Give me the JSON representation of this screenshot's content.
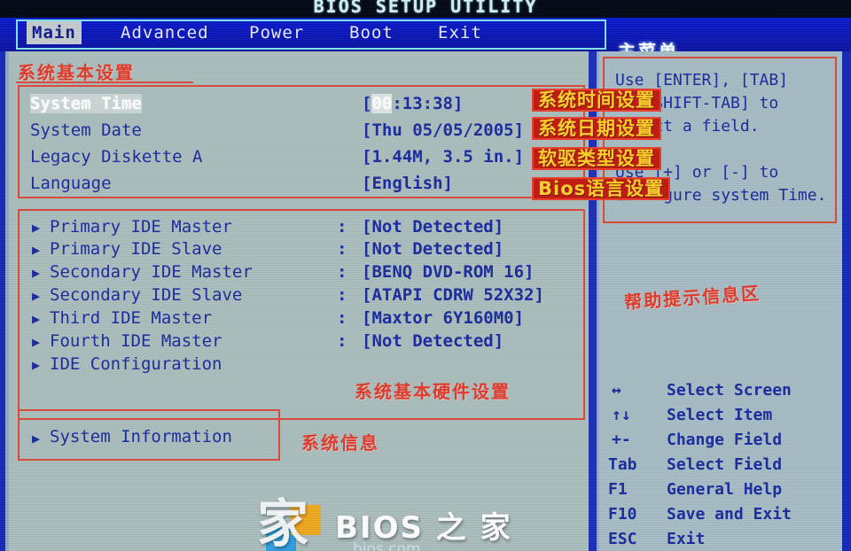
{
  "window": {
    "title": "BIOS SETUP UTILITY",
    "main_menu_label_cn": "主菜单"
  },
  "menu": {
    "items": [
      {
        "label": "Main",
        "active": true
      },
      {
        "label": "Advanced",
        "active": false
      },
      {
        "label": "Power",
        "active": false
      },
      {
        "label": "Boot",
        "active": false
      },
      {
        "label": "Exit",
        "active": false
      }
    ]
  },
  "main": {
    "section_basic_cn": "系统基本设置",
    "section_hardware_cn": "系统基本硬件设置",
    "section_sysinfo_cn": "系统信息",
    "basic_settings": [
      {
        "label": "System Time",
        "value": "[00:13:38]",
        "selected": true,
        "value_highlight": "00"
      },
      {
        "label": "System Date",
        "value": "[Thu 05/05/2005]",
        "selected": false
      },
      {
        "label": "Legacy Diskette A",
        "value": "[1.44M, 3.5 in.]",
        "selected": false
      },
      {
        "label": "Language",
        "value": "[English]",
        "selected": false
      }
    ],
    "ide_devices": [
      {
        "label": "Primary IDE Master",
        "value": "[Not Detected]"
      },
      {
        "label": "Primary IDE Slave",
        "value": "[Not Detected]"
      },
      {
        "label": "Secondary IDE Master",
        "value": "[BENQ    DVD-ROM 16]"
      },
      {
        "label": "Secondary IDE Slave",
        "value": "[ATAPI   CDRW 52X32]"
      },
      {
        "label": "Third IDE Master",
        "value": "[Maxtor 6Y160M0]"
      },
      {
        "label": "Fourth IDE Master",
        "value": "[Not Detected]"
      },
      {
        "label": "IDE Configuration",
        "value": ""
      }
    ],
    "system_information": {
      "label": "System Information"
    }
  },
  "annotations": {
    "yellow": [
      "系统时间设置",
      "系统日期设置",
      "软驱类型设置",
      "Bios语言设置"
    ],
    "help_area_cn": "帮助提示信息区"
  },
  "help": {
    "lines": [
      "Use [ENTER], [TAB]",
      "or [SHIFT-TAB] to",
      "select a field.",
      "",
      "Use [+] or [-] to",
      "configure system Time."
    ]
  },
  "keys": [
    {
      "key": "↔",
      "desc": "Select Screen"
    },
    {
      "key": "↑↓",
      "desc": "Select Item"
    },
    {
      "key": "+-",
      "desc": "Change Field"
    },
    {
      "key": "Tab",
      "desc": "Select Field"
    },
    {
      "key": "F1",
      "desc": "General Help"
    },
    {
      "key": "F10",
      "desc": "Save and Exit"
    },
    {
      "key": "ESC",
      "desc": "Exit"
    }
  ],
  "watermark": {
    "logo_glyph": "家",
    "title": "BIOS 之 家",
    "subtitle": "bios.com"
  },
  "colors": {
    "menubar_blue": "#0a16b4",
    "panel_bg": "#aabdbd",
    "text_blue": "#1a2a9e",
    "annotation_red": "#e03a2a",
    "annotation_yellow": "#ffd22a"
  }
}
